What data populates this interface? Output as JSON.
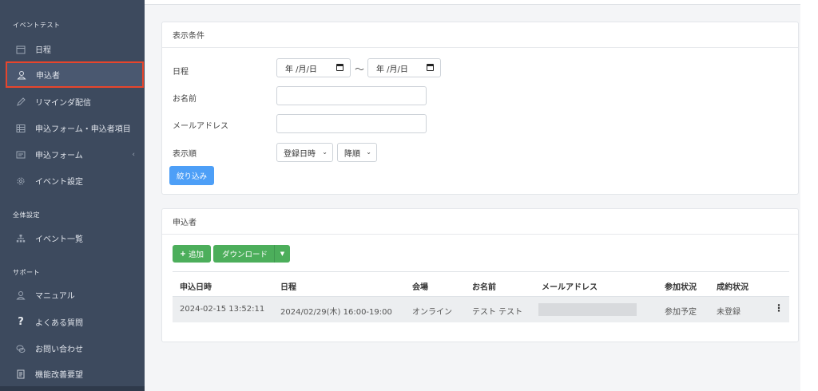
{
  "sidebar": {
    "section_event": "イベントテスト",
    "section_global": "全体設定",
    "section_support": "サポート",
    "items": [
      {
        "label": "日程",
        "icon": "calendar-icon"
      },
      {
        "label": "申込者",
        "icon": "user-icon"
      },
      {
        "label": "リマインダ配信",
        "icon": "pencil-icon"
      },
      {
        "label": "申込フォーム・申込者項目",
        "icon": "table-icon"
      },
      {
        "label": "申込フォーム",
        "icon": "form-icon"
      },
      {
        "label": "イベント設定",
        "icon": "gear-icon"
      },
      {
        "label": "イベント一覧",
        "icon": "sitemap-icon"
      },
      {
        "label": "マニュアル",
        "icon": "user-icon"
      },
      {
        "label": "よくある質問",
        "icon": "question-icon"
      },
      {
        "label": "お問い合わせ",
        "icon": "chat-icon"
      },
      {
        "label": "機能改善要望",
        "icon": "document-icon"
      }
    ],
    "chevron": "‹"
  },
  "filter": {
    "title": "表示条件",
    "date_label": "日程",
    "date_from": "年 /月/日",
    "tilde": "〜",
    "date_to": "年 /月/日",
    "name_label": "お名前",
    "email_label": "メールアドレス",
    "order_label": "表示順",
    "order_by": "登録日時",
    "order_dir": "降順",
    "submit": "絞り込み"
  },
  "applicants": {
    "title": "申込者",
    "add_button": "追加",
    "download_button": "ダウンロード",
    "headers": [
      "申込日時",
      "日程",
      "会場",
      "お名前",
      "メールアドレス",
      "参加状況",
      "成約状況"
    ],
    "rows": [
      {
        "applied_at": "2024-02-15 13:52:11",
        "schedule": "2024/02/29(木) 16:00-19:00",
        "venue": "オンライン",
        "name": "テスト テスト",
        "email": "",
        "attendance": "参加予定",
        "contract": "未登録"
      }
    ]
  },
  "colors": {
    "sidebar_bg": "#3d4a5e",
    "highlight": "#e8452c",
    "primary": "#4d9ff7",
    "success": "#4cae5b"
  }
}
